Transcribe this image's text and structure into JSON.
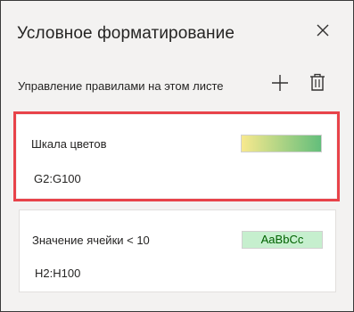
{
  "pane": {
    "title": "Условное форматирование",
    "close_icon": "close-icon"
  },
  "rules_header": {
    "label": "Управление правилами на этом листе",
    "add_icon": "plus-icon",
    "delete_icon": "trash-icon"
  },
  "rules": [
    {
      "name": "Шкала цветов",
      "range": "G2:G100",
      "preview": {
        "type": "color-scale",
        "colors": [
          "#f8e98e",
          "#63be7b"
        ]
      },
      "selected": true
    },
    {
      "name": "Значение ячейки < 10",
      "range": "H2:H100",
      "preview": {
        "type": "format-sample",
        "text": "AaBbCc",
        "fill": "#c6efce",
        "font_color": "#006100"
      },
      "selected": false
    }
  ],
  "colors": {
    "selection_border": "#e8434a",
    "pane_background": "#f3f2f1",
    "card_background": "#ffffff"
  }
}
